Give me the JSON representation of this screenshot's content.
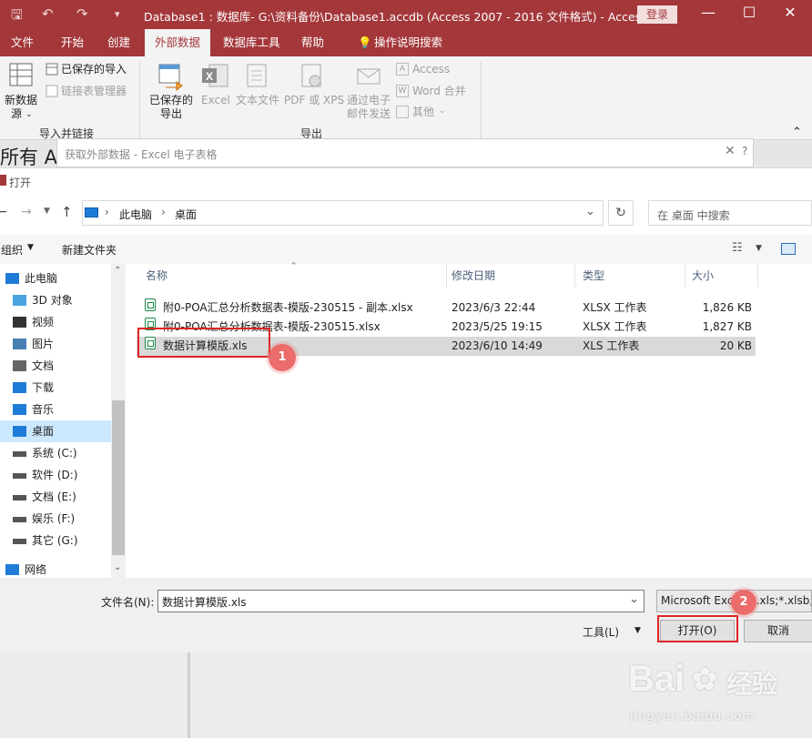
{
  "titlebar": {
    "title": "Database1 : 数据库- G:\\资料备份\\Database1.accdb (Access 2007 - 2016 文件格式)  -  Access",
    "login": "登录"
  },
  "tabs": [
    {
      "label": "文件"
    },
    {
      "label": "开始"
    },
    {
      "label": "创建"
    },
    {
      "label": "外部数据"
    },
    {
      "label": "数据库工具"
    },
    {
      "label": "帮助"
    },
    {
      "label": "操作说明搜索"
    }
  ],
  "ribbon": {
    "new_source_line1": "新数据",
    "new_source_line2": "源",
    "saved_imports": "已保存的导入",
    "linked_table_manager": "链接表管理器",
    "import_group": "导入并链接",
    "saved_exports_line1": "已保存的",
    "saved_exports_line2": "导出",
    "excel": "Excel",
    "text_file": "文本文件",
    "pdf_xps": "PDF 或 XPS",
    "email_line1": "通过电子",
    "email_line2": "邮件发送",
    "access": "Access",
    "word_merge": "Word 合并",
    "other": "其他",
    "export_group": "导出"
  },
  "background": {
    "nav_title": "所有 A"
  },
  "dialog_get_data": {
    "title": "获取外部数据 - Excel 电子表格",
    "help": "?",
    "close": "✕"
  },
  "open_dialog": {
    "caption": "打开",
    "breadcrumb": [
      "此电脑",
      "桌面"
    ],
    "search_placeholder": "在 桌面 中搜索",
    "organize": "组织",
    "new_folder": "新建文件夹",
    "nav_items": [
      {
        "label": "此电脑",
        "icon": "pc-icon"
      },
      {
        "label": "3D 对象",
        "icon": "cube-icon"
      },
      {
        "label": "视频",
        "icon": "video-icon"
      },
      {
        "label": "图片",
        "icon": "picture-icon"
      },
      {
        "label": "文档",
        "icon": "document-icon"
      },
      {
        "label": "下载",
        "icon": "download-icon"
      },
      {
        "label": "音乐",
        "icon": "music-icon"
      },
      {
        "label": "桌面",
        "icon": "desktop-icon"
      },
      {
        "label": "系统 (C:)",
        "icon": "drive-icon"
      },
      {
        "label": "软件 (D:)",
        "icon": "drive-icon"
      },
      {
        "label": "文档 (E:)",
        "icon": "drive-icon"
      },
      {
        "label": "娱乐 (F:)",
        "icon": "drive-icon"
      },
      {
        "label": "其它 (G:)",
        "icon": "drive-icon"
      },
      {
        "label": "网络",
        "icon": "network-icon"
      }
    ],
    "columns": {
      "name": "名称",
      "modified": "修改日期",
      "type": "类型",
      "size": "大小"
    },
    "files": [
      {
        "name": "附0-POA汇总分析数据表-模版-230515 - 副本.xlsx",
        "modified": "2023/6/3 22:44",
        "type": "XLSX 工作表",
        "size": "1,826 KB"
      },
      {
        "name": "附0-POA汇总分析数据表-模版-230515.xlsx",
        "modified": "2023/5/25 19:15",
        "type": "XLSX 工作表",
        "size": "1,827 KB"
      },
      {
        "name": "数据计算模版.xls",
        "modified": "2023/6/10 14:49",
        "type": "XLS 工作表",
        "size": "20 KB"
      }
    ],
    "filename_label": "文件名(N):",
    "filename_value": "数据计算模版.xls",
    "filetype_value": "Microsoft Excel (*.xls;*.xlsb;*.",
    "tools": "工具(L)",
    "open_button": "打开(O)",
    "cancel_button": "取消"
  },
  "annotations": {
    "badge1": "1",
    "badge2": "2"
  },
  "watermark": {
    "brand": "Bai",
    "brand2": "经验",
    "url": "jingyan.baidu.com"
  },
  "colors": {
    "accent": "#a4373a",
    "annotation": "#e02424",
    "badge": "#ec6b6b",
    "selection": "#cce8ff"
  }
}
